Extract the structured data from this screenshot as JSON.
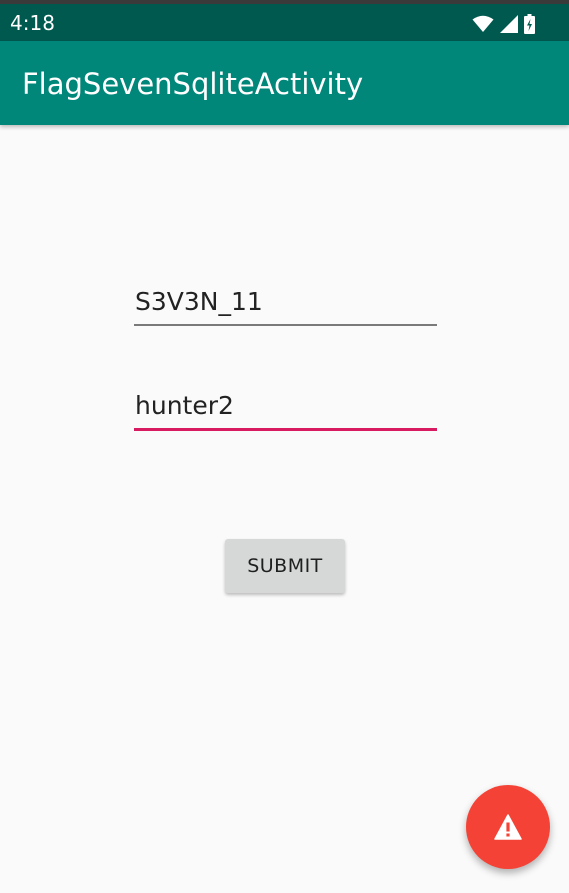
{
  "status_bar": {
    "time": "4:18",
    "icons": [
      "wifi-icon",
      "cell-signal-icon",
      "battery-charging-icon"
    ],
    "color": "#00594f"
  },
  "app_bar": {
    "title": "FlagSevenSqliteActivity",
    "color": "#00877a"
  },
  "form": {
    "username_value": "S3V3N_11",
    "password_value": "hunter2",
    "focused_underline_color": "#d81b60",
    "submit_label": "SUBMIT"
  },
  "fab": {
    "icon": "warning-icon",
    "color": "#f44336"
  }
}
